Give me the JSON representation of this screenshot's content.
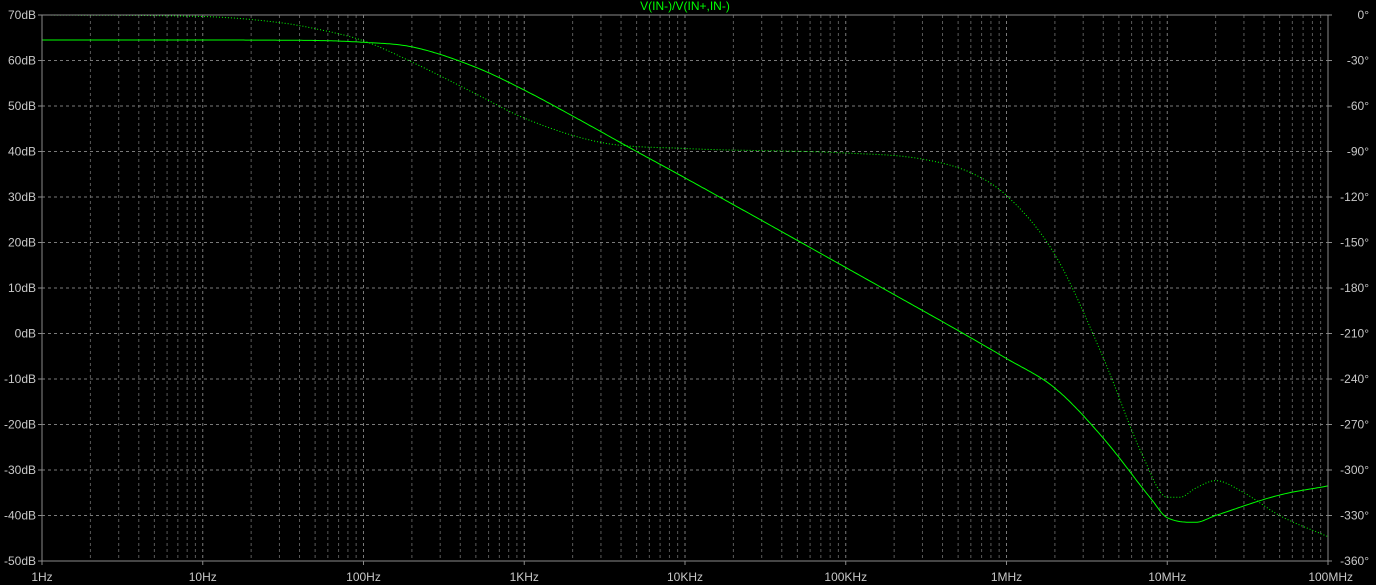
{
  "chart_data": {
    "type": "line",
    "title": "V(IN-)/V(IN+,IN-)",
    "x_scale": "log",
    "xlim_hz": [
      1,
      100000000
    ],
    "x_tick_values": [
      1,
      10,
      100,
      1000,
      10000,
      100000,
      1000000,
      10000000,
      100000000
    ],
    "x_tick_labels": [
      "1Hz",
      "10Hz",
      "100Hz",
      "1KHz",
      "10KHz",
      "100KHz",
      "1MHz",
      "10MHz",
      "100MHz"
    ],
    "y_left": {
      "unit": "dB",
      "lim": [
        -50,
        70
      ],
      "ticks": [
        70,
        60,
        50,
        40,
        30,
        20,
        10,
        0,
        -10,
        -20,
        -30,
        -40,
        -50
      ],
      "tick_labels": [
        "70dB",
        "60dB",
        "50dB",
        "40dB",
        "30dB",
        "20dB",
        "10dB",
        "0dB",
        "-10dB",
        "-20dB",
        "-30dB",
        "-40dB",
        "-50dB"
      ]
    },
    "y_right": {
      "unit": "deg",
      "lim": [
        -360,
        0
      ],
      "ticks": [
        0,
        -30,
        -60,
        -90,
        -120,
        -150,
        -180,
        -210,
        -240,
        -270,
        -300,
        -330,
        -360
      ],
      "tick_labels": [
        "0°",
        "-30°",
        "-60°",
        "-90°",
        "-120°",
        "-150°",
        "-180°",
        "-210°",
        "-240°",
        "-270°",
        "-300°",
        "-330°",
        "-360°"
      ]
    },
    "grid": true,
    "series": [
      {
        "axis": "left",
        "style": "solid",
        "color": "#00ff00",
        "x": [
          1,
          10,
          50,
          100,
          200,
          500,
          1000,
          2000,
          5000,
          10000,
          100000,
          1000000,
          2000000,
          4000000,
          8000000,
          10000000,
          15000000,
          20000000,
          50000000,
          100000000
        ],
        "y": [
          64.5,
          64.5,
          64.4,
          64.0,
          63.0,
          58.5,
          53.5,
          47.8,
          40.0,
          34.2,
          14.5,
          -5.5,
          -12.0,
          -23.0,
          -36.5,
          -40.5,
          -41.5,
          -40.0,
          -35.5,
          -33.5
        ]
      },
      {
        "axis": "right",
        "style": "dotted",
        "color": "#00ff00",
        "x": [
          1,
          10,
          30,
          50,
          100,
          200,
          500,
          1000,
          3000,
          10000,
          100000,
          300000,
          600000,
          1000000,
          2000000,
          4000000,
          7000000,
          10000000,
          12000000,
          15000000,
          20000000,
          30000000,
          50000000,
          100000000
        ],
        "y": [
          0,
          -1,
          -5,
          -9,
          -17,
          -31,
          -52,
          -68,
          -84,
          -88,
          -91,
          -95,
          -104,
          -119,
          -158,
          -226,
          -290,
          -318,
          -318,
          -312,
          -307,
          -315,
          -330,
          -344
        ]
      }
    ]
  }
}
